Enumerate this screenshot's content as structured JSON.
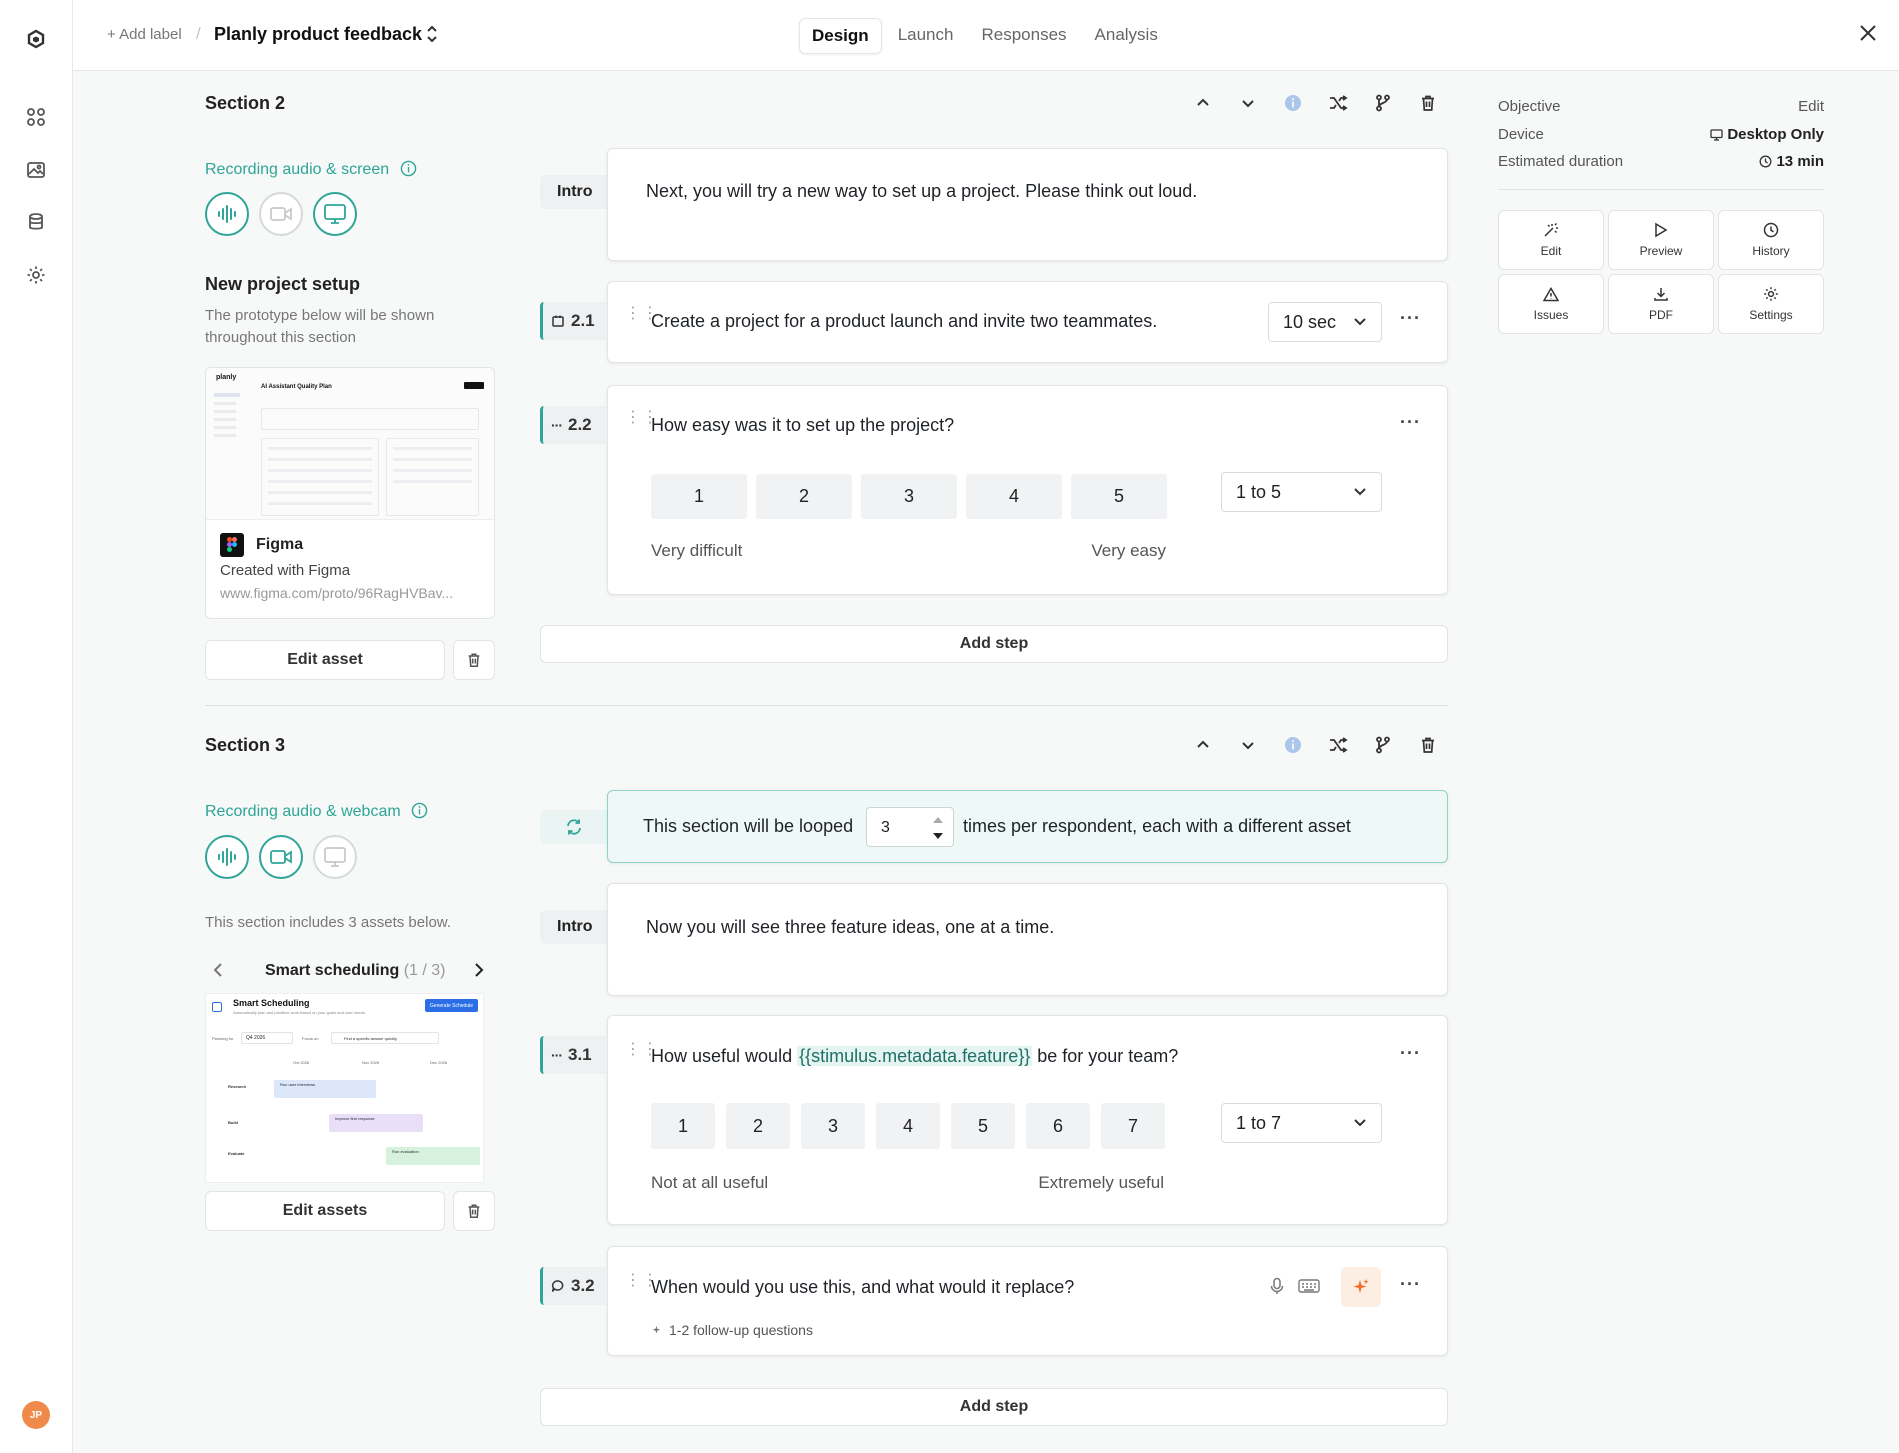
{
  "topbar": {
    "add_label": "+ Add label",
    "separator": "/",
    "project_title": "Planly product feedback",
    "tabs": [
      "Design",
      "Launch",
      "Responses",
      "Analysis"
    ]
  },
  "avatar_initials": "JP",
  "right_panel": {
    "objective_label": "Objective",
    "objective_value": "Edit",
    "device_label": "Device",
    "device_value": "Desktop Only",
    "duration_label": "Estimated duration",
    "duration_value": "13 min",
    "tiles": [
      "Edit",
      "Preview",
      "History",
      "Issues",
      "PDF",
      "Settings"
    ]
  },
  "section2": {
    "title": "Section 2",
    "recording_label": "Recording audio & screen",
    "asset_title": "New project setup",
    "asset_desc": "The prototype below will be shown throughout this section",
    "asset_source": "Figma",
    "asset_created": "Created with Figma",
    "asset_url": "www.figma.com/proto/96RagHVBav...",
    "edit_asset": "Edit asset",
    "intro_pill": "Intro",
    "intro_text": "Next, you will try a new way to set up a project. Please think out loud.",
    "step1_num": "2.1",
    "step1_text": "Create a project for a product launch and invite two teammates.",
    "step1_time": "10 sec",
    "step2_num": "2.2",
    "step2_text": "How easy was it to set up the project?",
    "step2_scale": [
      "1",
      "2",
      "3",
      "4",
      "5"
    ],
    "step2_low": "Very difficult",
    "step2_high": "Very easy",
    "step2_range": "1 to 5",
    "add_step": "Add step"
  },
  "section3": {
    "title": "Section 3",
    "recording_label": "Recording audio & webcam",
    "asset_desc": "This section includes 3 assets below.",
    "carousel_title": "Smart scheduling",
    "carousel_count": "(1 / 3)",
    "edit_assets": "Edit assets",
    "loop_pre": "This section will be looped",
    "loop_count": "3",
    "loop_post": "times per respondent, each with a different asset",
    "intro_pill": "Intro",
    "intro_text": "Now you will see three feature ideas, one at a time.",
    "step1_num": "3.1",
    "step1_pre": "How useful would ",
    "step1_var": "{{stimulus.metadata.feature}}",
    "step1_post": " be for your team?",
    "step1_scale": [
      "1",
      "2",
      "3",
      "4",
      "5",
      "6",
      "7"
    ],
    "step1_low": "Not at all useful",
    "step1_high": "Extremely useful",
    "step1_range": "1 to 7",
    "step2_num": "3.2",
    "step2_text": "When would you use this, and what would it replace?",
    "step2_followup": "1-2 follow-up questions",
    "add_step": "Add step"
  },
  "thumb1": {
    "brand": "planly",
    "title": "AI Assistant Quality Plan"
  },
  "thumb2": {
    "title": "Smart Scheduling",
    "subtitle": "Automatically plan and prioritize work based on your goals and user needs.",
    "button": "Generate Schedule",
    "planning_for": "Planning for",
    "quarter": "Q4 2026",
    "focus_on": "Focus on",
    "focus_value": "Find a specific answer quickly",
    "months": [
      "Oct 2026",
      "Nov 2026",
      "Dec 2026"
    ],
    "rows": [
      "Research",
      "Build",
      "Evaluate"
    ],
    "tasks": [
      "Run user interviews",
      "Improve first response",
      "Run evaluation"
    ]
  },
  "colors": {
    "accent": "#2ea597",
    "loop_bg": "#eef8f6",
    "ai_orange": "#f0712c"
  }
}
